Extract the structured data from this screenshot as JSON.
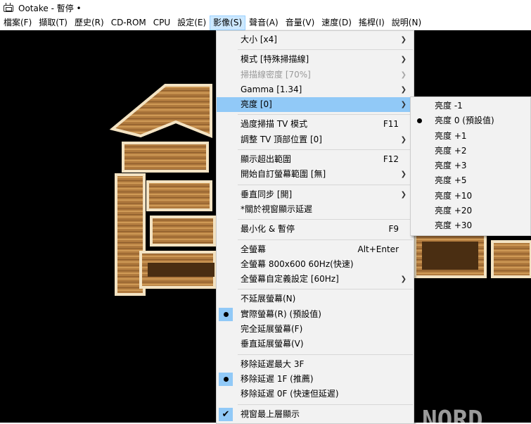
{
  "window": {
    "title": "Ootake - 暫停 •"
  },
  "menubar": [
    {
      "label": "檔案(F)"
    },
    {
      "label": "擷取(T)"
    },
    {
      "label": "歷史(R)"
    },
    {
      "label": "CD-ROM"
    },
    {
      "label": "CPU"
    },
    {
      "label": "設定(E)"
    },
    {
      "label": "影像(S)"
    },
    {
      "label": "聲音(A)"
    },
    {
      "label": "音量(V)"
    },
    {
      "label": "速度(D)"
    },
    {
      "label": "搖桿(I)"
    },
    {
      "label": "說明(N)"
    }
  ],
  "video_menu": {
    "items": [
      {
        "label": "大小  [x4]",
        "submenu": true
      },
      {
        "label": "模式  [特殊掃描線]",
        "submenu": true
      },
      {
        "label": "掃描線密度  [70%]",
        "submenu": true,
        "disabled": true
      },
      {
        "label": "Gamma  [1.34]",
        "submenu": true
      },
      {
        "label": "亮度  [0]",
        "submenu": true
      },
      {
        "label": "過度掃描 TV 模式",
        "shortcut": "F11"
      },
      {
        "label": "調整 TV 頂部位置  [0]",
        "submenu": true
      },
      {
        "label": "顯示超出範圍",
        "shortcut": "F12"
      },
      {
        "label": "開始自訂螢幕範圍  [無]",
        "submenu": true
      },
      {
        "label": "垂直同步  [開]",
        "submenu": true
      },
      {
        "label": "*關於視窗顯示延遲"
      },
      {
        "label": "最小化 & 暫停",
        "shortcut": "F9"
      },
      {
        "label": "全螢幕",
        "shortcut": "Alt+Enter"
      },
      {
        "label": "全螢幕 800x600 60Hz(快速)"
      },
      {
        "label": "全螢幕自定義設定  [60Hz]",
        "submenu": true
      },
      {
        "label": "不延展螢幕(N)"
      },
      {
        "label": "實際螢幕(R) (預設值)"
      },
      {
        "label": "完全延展螢幕(F)"
      },
      {
        "label": "垂直延展螢幕(V)"
      },
      {
        "label": "移除延遲最大 3F"
      },
      {
        "label": "移除延遲 1F (推薦)"
      },
      {
        "label": "移除延遲 0F (快速但延遲)"
      },
      {
        "label": "視窗最上層顯示"
      }
    ]
  },
  "brightness_submenu": {
    "items": [
      {
        "label": "亮度 -1"
      },
      {
        "label": "亮度  0 (預設值)"
      },
      {
        "label": "亮度 +1"
      },
      {
        "label": "亮度 +2"
      },
      {
        "label": "亮度 +3"
      },
      {
        "label": "亮度 +5"
      },
      {
        "label": "亮度 +10"
      },
      {
        "label": "亮度 +20"
      },
      {
        "label": "亮度 +30"
      }
    ]
  },
  "game": {
    "logo_text": "NORD"
  },
  "colors": {
    "highlight": "#91c9f7",
    "menu_bg": "#f2f2f2",
    "menubar_open": "#cce8ff",
    "game_bg": "#000000"
  }
}
